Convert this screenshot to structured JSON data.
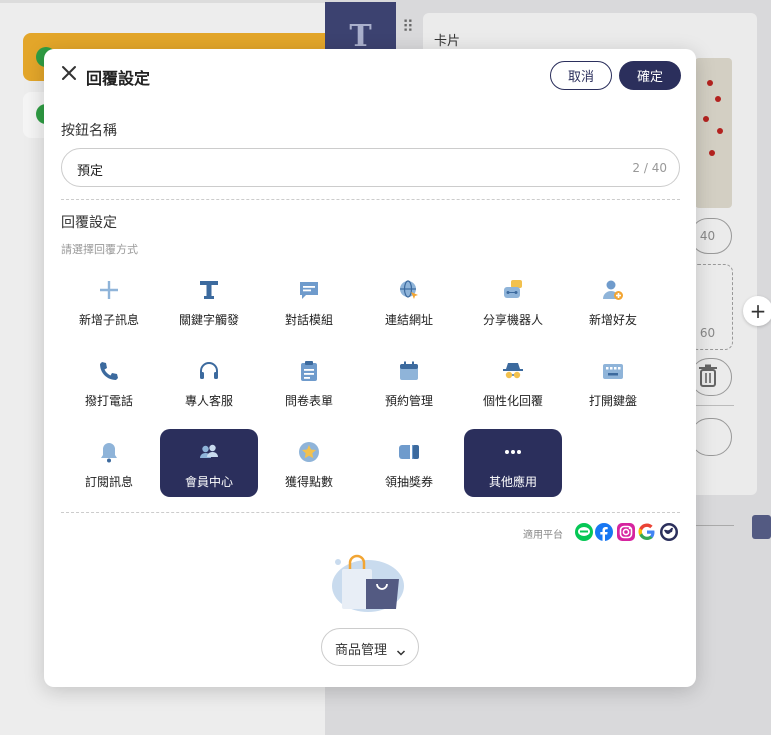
{
  "background": {
    "tile_letter": "T",
    "panel_title": "卡片",
    "count_a": "/ 40",
    "count_b": "/ 60"
  },
  "modal": {
    "title": "回覆設定",
    "cancel_label": "取消",
    "confirm_label": "確定",
    "button_name_label": "按鈕名稱",
    "button_name_value": "預定",
    "button_name_count": "2 / 40",
    "reply_settings_label": "回覆設定",
    "reply_hint": "請選擇回覆方式",
    "options": [
      {
        "label": "新增子訊息",
        "icon": "plus-icon",
        "active": false
      },
      {
        "label": "關鍵字觸發",
        "icon": "text-t-icon",
        "active": false
      },
      {
        "label": "對話模組",
        "icon": "chat-bubble-icon",
        "active": false
      },
      {
        "label": "連結網址",
        "icon": "globe-link-icon",
        "active": false
      },
      {
        "label": "分享機器人",
        "icon": "share-bot-icon",
        "active": false
      },
      {
        "label": "新增好友",
        "icon": "add-friend-icon",
        "active": false
      },
      {
        "label": "撥打電話",
        "icon": "phone-icon",
        "active": false
      },
      {
        "label": "專人客服",
        "icon": "headset-icon",
        "active": false
      },
      {
        "label": "問卷表單",
        "icon": "clipboard-icon",
        "active": false
      },
      {
        "label": "預約管理",
        "icon": "calendar-icon",
        "active": false
      },
      {
        "label": "個性化回覆",
        "icon": "spy-icon",
        "active": false
      },
      {
        "label": "打開鍵盤",
        "icon": "keyboard-icon",
        "active": false
      },
      {
        "label": "訂閱訊息",
        "icon": "bell-icon",
        "active": false
      },
      {
        "label": "會員中心",
        "icon": "members-icon",
        "active": true
      },
      {
        "label": "獲得點數",
        "icon": "star-coin-icon",
        "active": false
      },
      {
        "label": "領抽獎券",
        "icon": "ticket-icon",
        "active": false
      },
      {
        "label": "其他應用",
        "icon": "more-dots-icon",
        "active": true
      }
    ],
    "platforms_label": "適用平台",
    "platforms": [
      "line-icon",
      "facebook-icon",
      "instagram-icon",
      "google-icon",
      "webchat-icon"
    ],
    "product_select_value": "商品管理",
    "colors": {
      "primary": "#2b2f5c",
      "icon_light": "#8fb4d9",
      "icon_dark": "#3c6a9e"
    }
  }
}
